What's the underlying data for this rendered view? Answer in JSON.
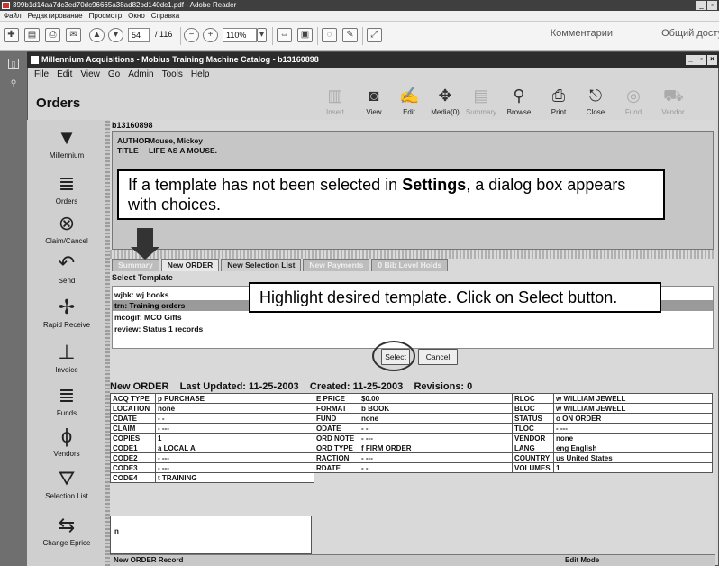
{
  "window": {
    "title": "399b1d14aa7dc3ed70dc96665a38ad82bd140dc1.pdf - Adobe Reader"
  },
  "viewer_menu": [
    "Файл",
    "Редактирование",
    "Просмотр",
    "Окно",
    "Справка"
  ],
  "viewer_toolbar": {
    "page_current": "54",
    "page_total": "/ 116",
    "zoom": "110%",
    "comments": "Комментарии",
    "shared": "Общий доступ"
  },
  "app": {
    "title": "Millennium Acquisitions - Mobius Training Machine Catalog - b13160898",
    "menu": [
      "File",
      "Edit",
      "View",
      "Go",
      "Admin",
      "Tools",
      "Help"
    ],
    "section_title": "Orders"
  },
  "tools": [
    {
      "label": "Insert",
      "icon": "insert-icon",
      "enabled": false
    },
    {
      "label": "View",
      "icon": "view-icon",
      "enabled": true
    },
    {
      "label": "Edit",
      "icon": "edit-icon",
      "enabled": true
    },
    {
      "label": "Media(0)",
      "icon": "media-icon",
      "enabled": true
    },
    {
      "label": "Summary",
      "icon": "summary-icon",
      "enabled": false
    },
    {
      "label": "Browse",
      "icon": "search-icon",
      "enabled": true
    },
    {
      "label": "Print",
      "icon": "print-icon",
      "enabled": true
    },
    {
      "label": "Close",
      "icon": "close-icon",
      "enabled": true
    },
    {
      "label": "Fund",
      "icon": "fund-icon",
      "enabled": false
    },
    {
      "label": "Vendor",
      "icon": "vendor-icon",
      "enabled": false
    }
  ],
  "nav": [
    {
      "label": "Millennium",
      "icon": "millennium-logo-icon"
    },
    {
      "label": "Orders",
      "icon": "orders-icon"
    },
    {
      "label": "Claim/Cancel",
      "icon": "claim-cancel-icon"
    },
    {
      "label": "Send",
      "icon": "send-icon"
    },
    {
      "label": "Rapid Receive",
      "icon": "rapid-receive-icon"
    },
    {
      "label": "Invoice",
      "icon": "invoice-icon"
    },
    {
      "label": "Funds",
      "icon": "funds-icon"
    },
    {
      "label": "Vendors",
      "icon": "vendors-icon"
    },
    {
      "label": "Selection List",
      "icon": "selection-list-icon"
    },
    {
      "label": "Change Eprice",
      "icon": "change-eprice-icon"
    }
  ],
  "record": {
    "id": "b13160898",
    "author_label": "AUTHOR",
    "author": "Mouse, Mickey",
    "title_label": "TITLE",
    "title": "LIFE AS A MOUSE."
  },
  "tabs": [
    "Summary",
    "New ORDER",
    "New Selection List",
    "New Payments",
    "0 Bib Level Holds"
  ],
  "template": {
    "heading": "Select Template",
    "items": [
      "wjbk: wj books",
      "trn: Training orders",
      "mcogif: MCO Gifts",
      "review: Status 1 records"
    ],
    "selected_index": 1,
    "select_label": "Select",
    "cancel_label": "Cancel"
  },
  "order": {
    "heading": "New ORDER    Last Updated: 11-25-2003    Created: 11-25-2003    Revisions: 0",
    "rows": [
      [
        [
          "ACQ TYPE",
          "p  PURCHASE"
        ],
        [
          "E PRICE",
          "$0.00"
        ],
        [
          "RLOC",
          "w  WILLIAM JEWELL"
        ]
      ],
      [
        [
          "LOCATION",
          "none"
        ],
        [
          "FORMAT",
          "b  BOOK"
        ],
        [
          "BLOC",
          "w  WILLIAM JEWELL"
        ]
      ],
      [
        [
          "CDATE",
          "- -"
        ],
        [
          "FUND",
          "none"
        ],
        [
          "STATUS",
          "o  ON ORDER"
        ]
      ],
      [
        [
          "CLAIM",
          "- ---"
        ],
        [
          "ODATE",
          "- -"
        ],
        [
          "TLOC",
          "- ---"
        ]
      ],
      [
        [
          "COPIES",
          "1"
        ],
        [
          "ORD NOTE",
          "- ---"
        ],
        [
          "VENDOR",
          "none"
        ]
      ],
      [
        [
          "CODE1",
          "a  LOCAL A"
        ],
        [
          "ORD TYPE",
          "f  FIRM ORDER"
        ],
        [
          "LANG",
          "eng  English"
        ]
      ],
      [
        [
          "CODE2",
          "- ---"
        ],
        [
          "RACTION",
          "- ---"
        ],
        [
          "COUNTRY",
          "us  United States"
        ]
      ],
      [
        [
          "CODE3",
          "- ---"
        ],
        [
          "RDATE",
          "- -"
        ],
        [
          "VOLUMES",
          "1"
        ]
      ],
      [
        [
          "CODE4",
          "t  TRAINING"
        ]
      ]
    ],
    "footer_value": "n",
    "status_left": "New ORDER Record",
    "status_right": "Edit Mode"
  },
  "callouts": {
    "top_pre": "If a template has not been selected in ",
    "top_bold": "Settings",
    "top_post": ", a dialog box appears with choices.",
    "bottom": "Highlight desired template.  Click on Select button."
  }
}
